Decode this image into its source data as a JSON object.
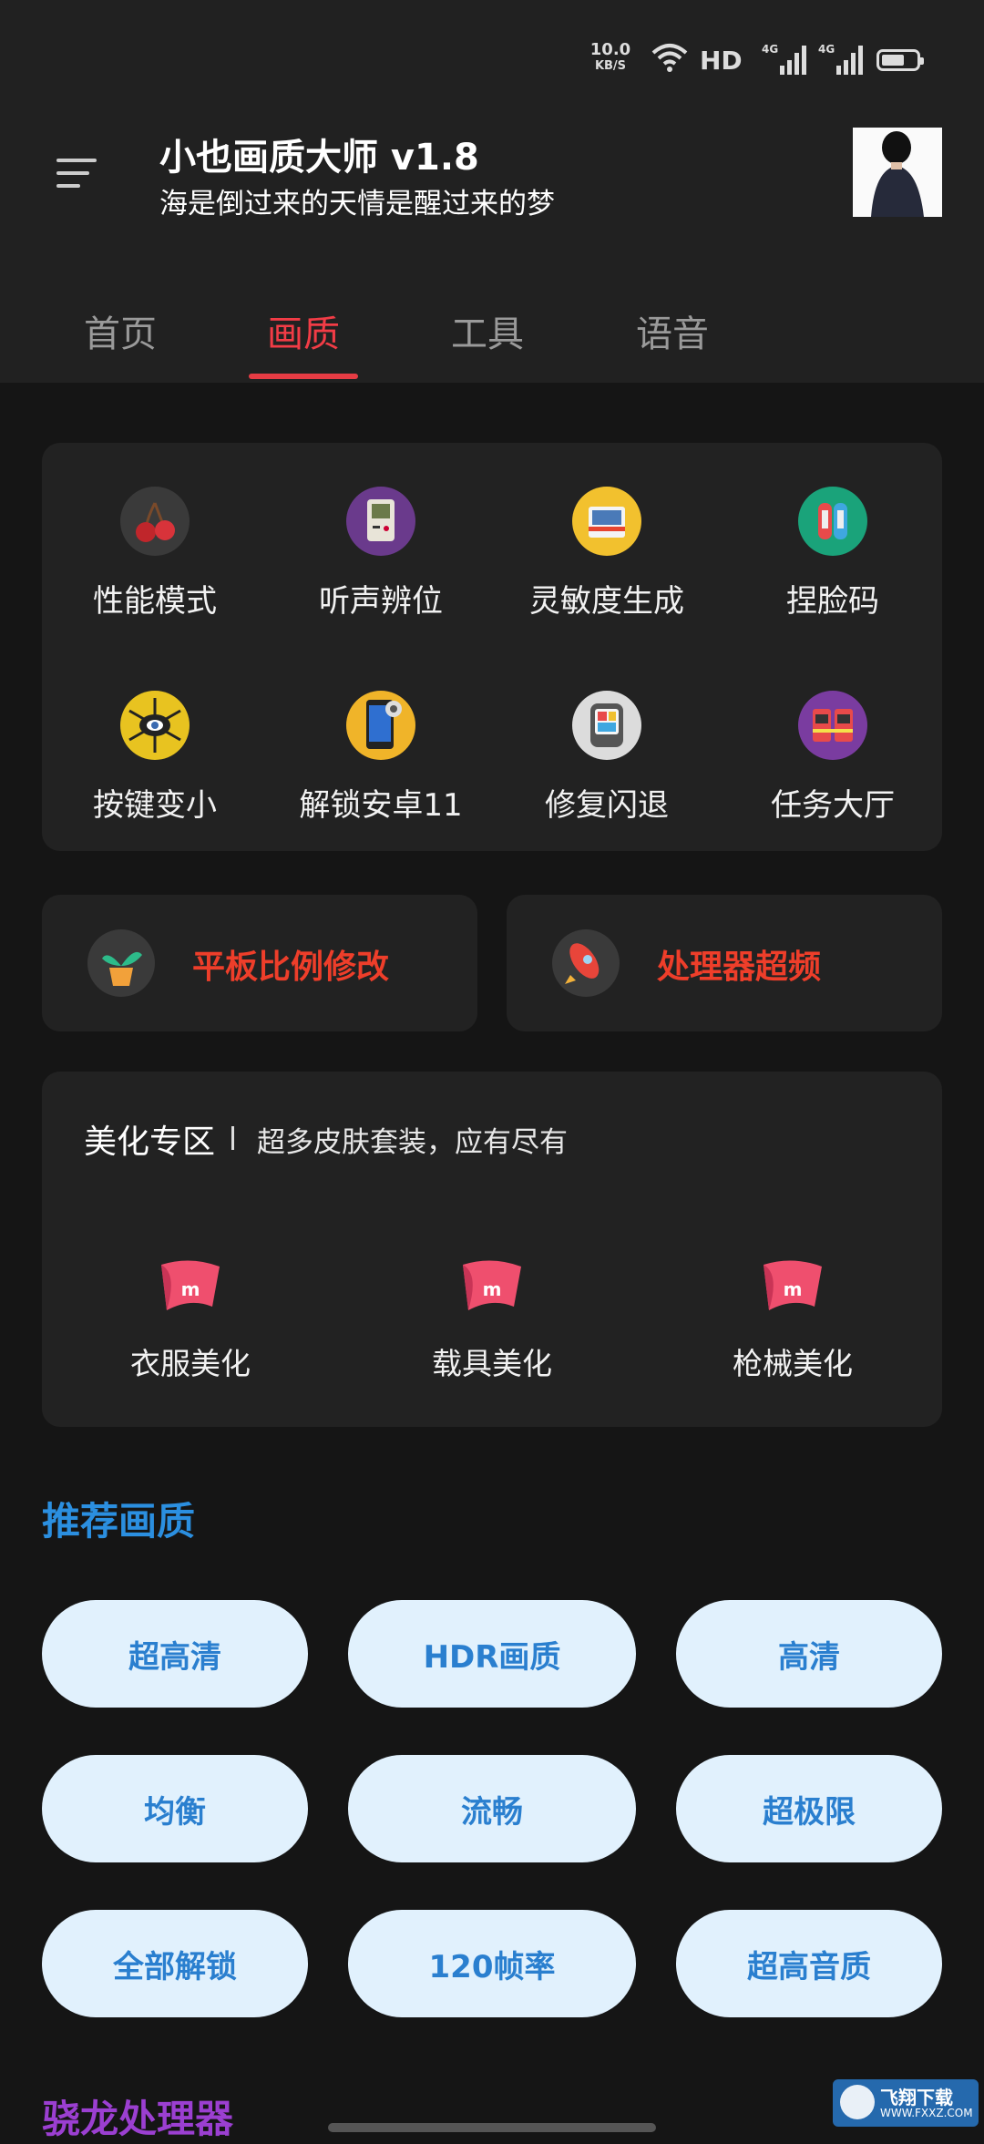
{
  "status_bar": {
    "net_speed": "10.0",
    "net_unit": "KB/S",
    "hd_label": "HD",
    "sig1_label": "4G",
    "sig2_label": "4G"
  },
  "header": {
    "title": "小也画质大师 v1.8",
    "subtitle": "海是倒过来的天情是醒过来的梦"
  },
  "tabs": [
    {
      "label": "首页"
    },
    {
      "label": "画质"
    },
    {
      "label": "工具"
    },
    {
      "label": "语音"
    }
  ],
  "grid": [
    {
      "label": "性能模式",
      "icon": "cherry-icon",
      "color": "#3a3a3a"
    },
    {
      "label": "听声辨位",
      "icon": "gameboy-icon",
      "color": "#6a3a8c"
    },
    {
      "label": "灵敏度生成",
      "icon": "camera-icon",
      "color": "#f2c12e"
    },
    {
      "label": "捏脸码",
      "icon": "switch-controller-icon",
      "color": "#1aa37a"
    },
    {
      "label": "按键变小",
      "icon": "spider-eye-icon",
      "color": "#e8c320"
    },
    {
      "label": "解锁安卓11",
      "icon": "phone-settings-icon",
      "color": "#f0b429"
    },
    {
      "label": "修复闪退",
      "icon": "device-icon",
      "color": "#dcdcdc"
    },
    {
      "label": "任务大厅",
      "icon": "arcade-icon",
      "color": "#7a3ca0"
    }
  ],
  "quick": [
    {
      "label": "平板比例修改",
      "icon": "plant-icon"
    },
    {
      "label": "处理器超频",
      "icon": "rocket-icon"
    }
  ],
  "beauty": {
    "title": "美化专区",
    "subtitle": "超多皮肤套装，应有尽有",
    "items": [
      {
        "label": "衣服美化",
        "icon_text": "m"
      },
      {
        "label": "载具美化",
        "icon_text": "m"
      },
      {
        "label": "枪械美化",
        "icon_text": "m"
      }
    ]
  },
  "recommended": {
    "title": "推荐画质",
    "title_color": "#2b8fe0",
    "buttons": [
      "超高清",
      "HDR画质",
      "高清",
      "均衡",
      "流畅",
      "超极限",
      "全部解锁",
      "120帧率",
      "超高音质"
    ]
  },
  "snapdragon": {
    "title": "骁龙处理器",
    "title_color": "#9b3fd1"
  },
  "watermark": {
    "site": "飞翔下载",
    "url": "WWW.FXXZ.COM"
  }
}
